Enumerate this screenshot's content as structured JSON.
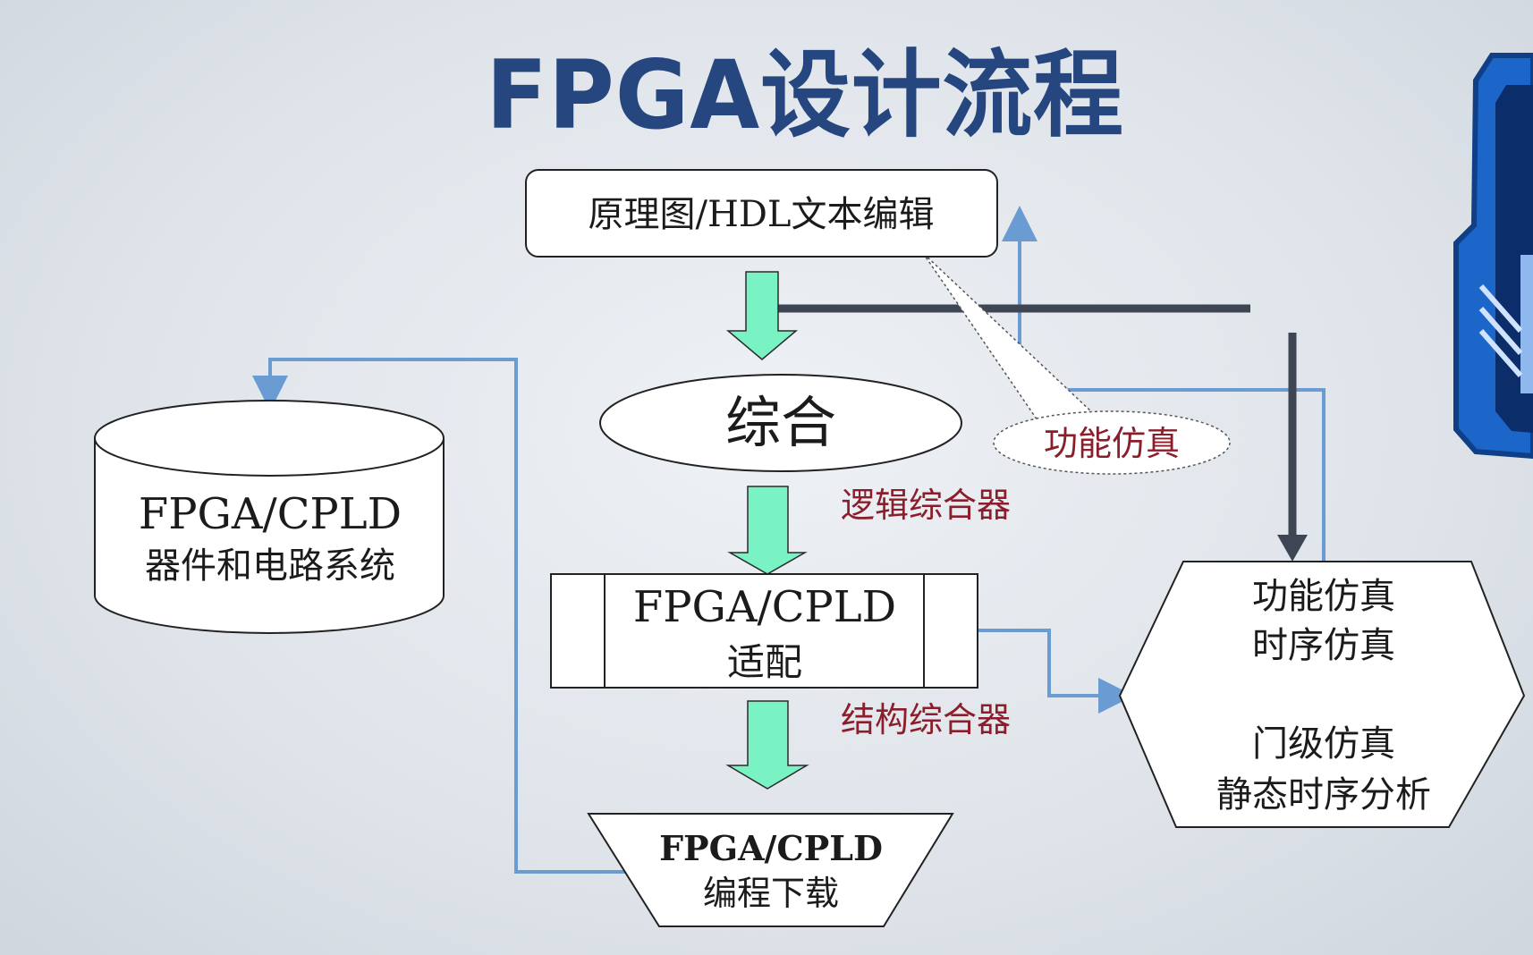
{
  "title": "FPGA设计流程",
  "nodes": {
    "editor": "原理图/HDL文本编辑",
    "synthesis": "综合",
    "fitting_line1": "FPGA/CPLD",
    "fitting_line2": "适配",
    "download_line1": "FPGA/CPLD",
    "download_line2": "编程下载",
    "device_line1": "FPGA/CPLD",
    "device_line2": "器件和电路系统",
    "sim_line1": "功能仿真",
    "sim_line2": "时序仿真",
    "sim_line3": "门级仿真",
    "sim_line4": "静态时序分析"
  },
  "labels": {
    "callout": "功能仿真",
    "logic_synth": "逻辑综合器",
    "struct_synth": "结构综合器"
  },
  "colors": {
    "title": "#25467e",
    "flow_arrow": "#79f2c4",
    "feedback_line": "#6a9bd3",
    "dark_bar": "#3d4652",
    "label_red": "#8b1e2b"
  }
}
